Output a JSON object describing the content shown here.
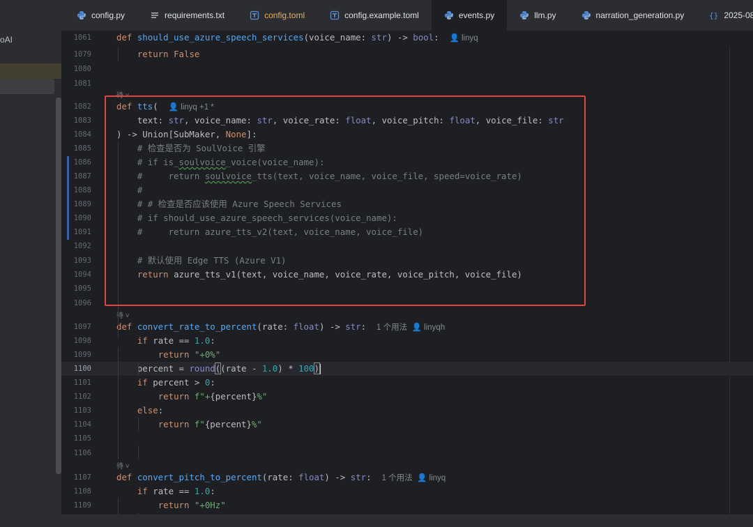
{
  "sidebar": {
    "project_name": "oAI"
  },
  "tabs": [
    {
      "label": "config.py",
      "icon": "python-icon",
      "type": "py"
    },
    {
      "label": "requirements.txt",
      "icon": "text-file-icon",
      "type": "txt"
    },
    {
      "label": "config.toml",
      "icon": "toml-icon",
      "type": "toml"
    },
    {
      "label": "config.example.toml",
      "icon": "toml-icon",
      "type": "toml"
    },
    {
      "label": "events.py",
      "icon": "python-icon",
      "type": "py",
      "active": true
    },
    {
      "label": "llm.py",
      "icon": "python-icon",
      "type": "py"
    },
    {
      "label": "narration_generation.py",
      "icon": "python-icon",
      "type": "py"
    },
    {
      "label": "2025-08",
      "icon": "json-icon",
      "type": "json"
    }
  ],
  "editor": {
    "fold_label": "待",
    "lines": [
      {
        "n": "1061",
        "tokens": [
          [
            "kw",
            "def "
          ],
          [
            "fn",
            "should_use_azure_speech_services"
          ],
          [
            "tx",
            "(voice_name: "
          ],
          [
            "bi",
            "str"
          ],
          [
            "tx",
            ") -> "
          ],
          [
            "bi",
            "bool"
          ],
          [
            "tx",
            ":  "
          ],
          [
            "hint",
            "👤 linyq"
          ]
        ]
      },
      {
        "n": "1079",
        "tokens": [
          [
            "tx",
            "    "
          ],
          [
            "kw",
            "return "
          ],
          [
            "kw",
            "False"
          ]
        ]
      },
      {
        "n": "1080",
        "tokens": []
      },
      {
        "n": "1081",
        "tokens": []
      },
      {
        "n": "1082",
        "tokens": [
          [
            "kw",
            "def "
          ],
          [
            "fn",
            "tts"
          ],
          [
            "tx",
            "(  "
          ],
          [
            "hint",
            "👤 linyq +1 *"
          ]
        ]
      },
      {
        "n": "1083",
        "tokens": [
          [
            "tx",
            "    text: "
          ],
          [
            "bi",
            "str"
          ],
          [
            "tx",
            ", voice_name: "
          ],
          [
            "bi",
            "str"
          ],
          [
            "tx",
            ", voice_rate: "
          ],
          [
            "bi",
            "float"
          ],
          [
            "tx",
            ", voice_pitch: "
          ],
          [
            "bi",
            "float"
          ],
          [
            "tx",
            ", voice_file: "
          ],
          [
            "bi",
            "str"
          ]
        ]
      },
      {
        "n": "1084",
        "tokens": [
          [
            "tx",
            ") -> Union[SubMaker, "
          ],
          [
            "kw",
            "None"
          ],
          [
            "tx",
            "]:"
          ]
        ]
      },
      {
        "n": "1085",
        "tokens": [
          [
            "cm",
            "    # 检查是否为 SoulVoice 引擎"
          ]
        ]
      },
      {
        "n": "1086",
        "tokens": [
          [
            "cm",
            "    # if is_"
          ],
          [
            "cmu",
            "soulvoice"
          ],
          [
            "cm",
            "_voice(voice_name):"
          ]
        ]
      },
      {
        "n": "1087",
        "tokens": [
          [
            "cm",
            "    #     return "
          ],
          [
            "cmu",
            "soulvoice"
          ],
          [
            "cm",
            "_tts(text, voice_name, voice_file, speed=voice_rate)"
          ]
        ]
      },
      {
        "n": "1088",
        "tokens": [
          [
            "cm",
            "    #"
          ]
        ]
      },
      {
        "n": "1089",
        "tokens": [
          [
            "cm",
            "    # # 检查是否应该使用 Azure Speech Services"
          ]
        ]
      },
      {
        "n": "1090",
        "tokens": [
          [
            "cm",
            "    # if should_use_azure_speech_services(voice_name):"
          ]
        ]
      },
      {
        "n": "1091",
        "tokens": [
          [
            "cm",
            "    #     return azure_tts_v2(text, voice_name, voice_file)"
          ]
        ]
      },
      {
        "n": "1092",
        "tokens": []
      },
      {
        "n": "1093",
        "tokens": [
          [
            "cm",
            "    # 默认使用 Edge TTS (Azure V1)"
          ]
        ]
      },
      {
        "n": "1094",
        "tokens": [
          [
            "tx",
            "    "
          ],
          [
            "kw",
            "return "
          ],
          [
            "tx",
            "azure_tts_v1(text, voice_name, voice_rate, voice_pitch, voice_file)"
          ]
        ]
      },
      {
        "n": "1095",
        "tokens": []
      },
      {
        "n": "1096",
        "tokens": []
      },
      {
        "n": "1097",
        "tokens": [
          [
            "kw",
            "def "
          ],
          [
            "fn",
            "convert_rate_to_percent"
          ],
          [
            "tx",
            "(rate: "
          ],
          [
            "bi",
            "float"
          ],
          [
            "tx",
            ") -> "
          ],
          [
            "bi",
            "str"
          ],
          [
            "tx",
            ":  "
          ],
          [
            "hint",
            "1 个用法  👤 linyqh"
          ]
        ]
      },
      {
        "n": "1098",
        "tokens": [
          [
            "tx",
            "    "
          ],
          [
            "kw",
            "if "
          ],
          [
            "tx",
            "rate == "
          ],
          [
            "num",
            "1.0"
          ],
          [
            "tx",
            ":"
          ]
        ]
      },
      {
        "n": "1099",
        "tokens": [
          [
            "tx",
            "        "
          ],
          [
            "kw",
            "return "
          ],
          [
            "str",
            "\"+0%\""
          ]
        ]
      },
      {
        "n": "1100",
        "current": true,
        "tokens": [
          [
            "tx",
            "    percent = "
          ],
          [
            "bi",
            "round"
          ],
          [
            "brk",
            "("
          ],
          [
            "tx",
            "(rate - "
          ],
          [
            "num",
            "1.0"
          ],
          [
            "tx",
            ") * "
          ],
          [
            "num",
            "100"
          ],
          [
            "brk",
            ")"
          ],
          [
            "caret",
            ""
          ]
        ]
      },
      {
        "n": "1101",
        "tokens": [
          [
            "tx",
            "    "
          ],
          [
            "kw",
            "if "
          ],
          [
            "tx",
            "percent > "
          ],
          [
            "num",
            "0"
          ],
          [
            "tx",
            ":"
          ]
        ]
      },
      {
        "n": "1102",
        "tokens": [
          [
            "tx",
            "        "
          ],
          [
            "kw",
            "return "
          ],
          [
            "str",
            "f\"+"
          ],
          [
            "tx",
            "{percent}"
          ],
          [
            "str",
            "%\""
          ]
        ]
      },
      {
        "n": "1103",
        "tokens": [
          [
            "tx",
            "    "
          ],
          [
            "kw",
            "else"
          ],
          [
            "tx",
            ":"
          ]
        ]
      },
      {
        "n": "1104",
        "tokens": [
          [
            "tx",
            "        "
          ],
          [
            "kw",
            "return "
          ],
          [
            "str",
            "f\""
          ],
          [
            "tx",
            "{percent}"
          ],
          [
            "str",
            "%\""
          ]
        ]
      },
      {
        "n": "1105",
        "tokens": []
      },
      {
        "n": "1106",
        "tokens": []
      },
      {
        "n": "1107",
        "tokens": [
          [
            "kw",
            "def "
          ],
          [
            "fn",
            "convert_pitch_to_percent"
          ],
          [
            "tx",
            "(rate: "
          ],
          [
            "bi",
            "float"
          ],
          [
            "tx",
            ") -> "
          ],
          [
            "bi",
            "str"
          ],
          [
            "tx",
            ":  "
          ],
          [
            "hint",
            "1 个用法  👤 linyq"
          ]
        ]
      },
      {
        "n": "1108",
        "tokens": [
          [
            "tx",
            "    "
          ],
          [
            "kw",
            "if "
          ],
          [
            "tx",
            "rate == "
          ],
          [
            "num",
            "1.0"
          ],
          [
            "tx",
            ":"
          ]
        ]
      },
      {
        "n": "1109",
        "tokens": [
          [
            "tx",
            "        "
          ],
          [
            "kw",
            "return "
          ],
          [
            "str",
            "\"+0Hz\""
          ]
        ]
      }
    ]
  }
}
